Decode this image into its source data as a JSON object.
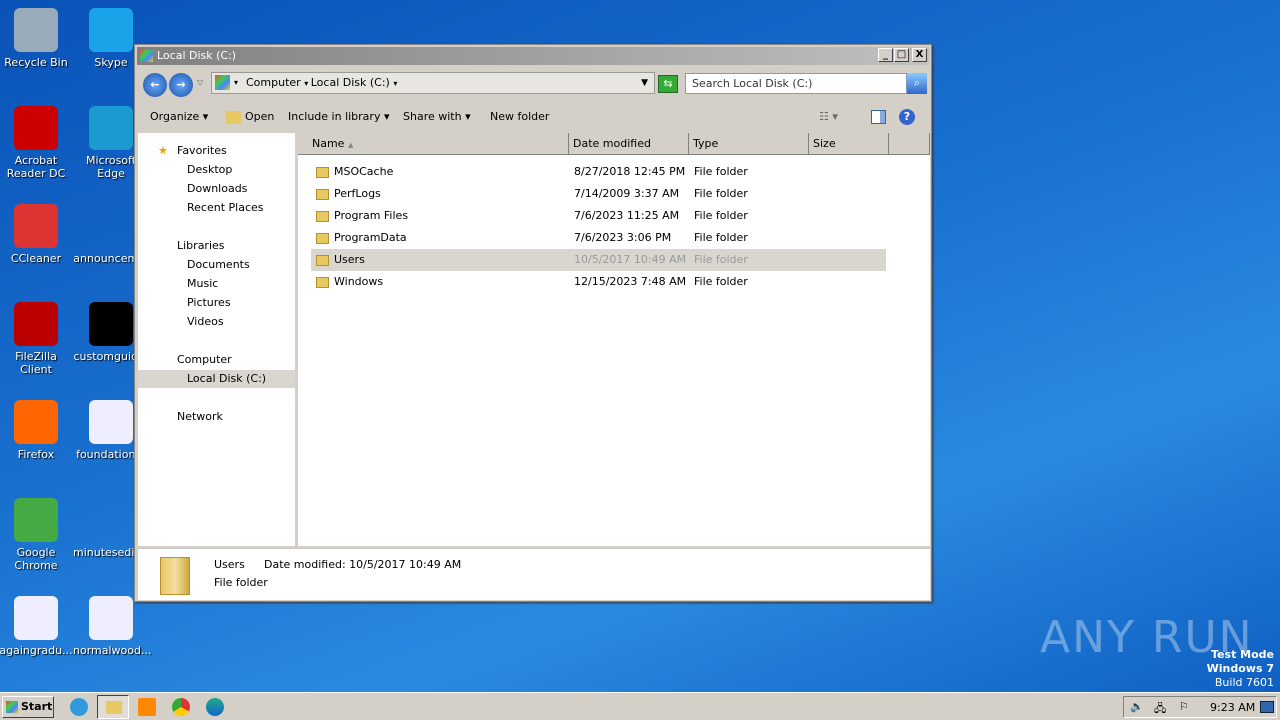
{
  "desktop": {
    "icons": [
      {
        "label": "Recycle Bin",
        "color": "#9ab"
      },
      {
        "label": "Skype",
        "color": "#1aa3e8"
      },
      {
        "label": "Acrobat Reader DC",
        "color": "#c00"
      },
      {
        "label": "Microsoft Edge",
        "color": "#1a9ad0"
      },
      {
        "label": "CCleaner",
        "color": "#d33"
      },
      {
        "label": "announcem...",
        "color": "transparent"
      },
      {
        "label": "FileZilla Client",
        "color": "#b00"
      },
      {
        "label": "customguid...",
        "color": "#000"
      },
      {
        "label": "Firefox",
        "color": "#f60"
      },
      {
        "label": "foundation...",
        "color": "#eef"
      },
      {
        "label": "Google Chrome",
        "color": "#4a4"
      },
      {
        "label": "minutesedit...",
        "color": "transparent"
      },
      {
        "label": "againgradu...",
        "color": "#eef"
      },
      {
        "label": "normalwood...",
        "color": "#eef"
      }
    ],
    "watermark": "ANY RUN",
    "test_mode": "Test Mode",
    "os": "Windows 7",
    "build": "Build 7601"
  },
  "window": {
    "title": "Local Disk (C:)",
    "breadcrumb": [
      "Computer",
      "Local Disk (C:)"
    ],
    "search_placeholder": "Search Local Disk (C:)",
    "toolbar": {
      "organize": "Organize",
      "open": "Open",
      "include": "Include in library",
      "share": "Share with",
      "new_folder": "New folder"
    },
    "nav": {
      "favorites": "Favorites",
      "desktop": "Desktop",
      "downloads": "Downloads",
      "recent": "Recent Places",
      "libraries": "Libraries",
      "documents": "Documents",
      "music": "Music",
      "pictures": "Pictures",
      "videos": "Videos",
      "computer": "Computer",
      "local_disk": "Local Disk (C:)",
      "network": "Network"
    },
    "columns": {
      "name": "Name",
      "date": "Date modified",
      "type": "Type",
      "size": "Size"
    },
    "files": [
      {
        "name": "MSOCache",
        "date": "8/27/2018 12:45 PM",
        "type": "File folder"
      },
      {
        "name": "PerfLogs",
        "date": "7/14/2009 3:37 AM",
        "type": "File folder"
      },
      {
        "name": "Program Files",
        "date": "7/6/2023 11:25 AM",
        "type": "File folder"
      },
      {
        "name": "ProgramData",
        "date": "7/6/2023 3:06 PM",
        "type": "File folder"
      },
      {
        "name": "Users",
        "date": "10/5/2017 10:49 AM",
        "type": "File folder",
        "selected": true
      },
      {
        "name": "Windows",
        "date": "12/15/2023 7:48 AM",
        "type": "File folder"
      }
    ],
    "details": {
      "name": "Users",
      "date": "Date modified: 10/5/2017 10:49 AM",
      "type": "File folder"
    }
  },
  "taskbar": {
    "start": "Start",
    "clock": "9:23 AM"
  }
}
